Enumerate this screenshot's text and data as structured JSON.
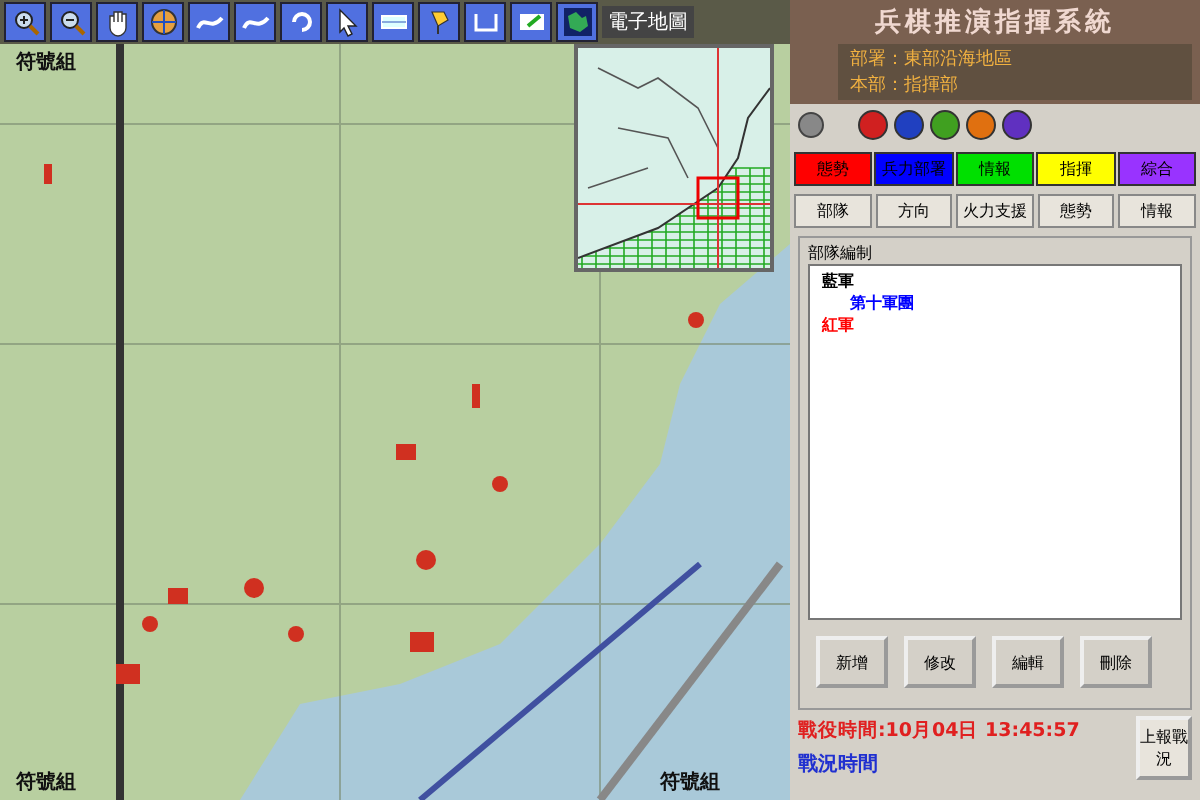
{
  "toolbar": {
    "tools": [
      {
        "kind": "zoom-in"
      },
      {
        "kind": "zoom-out"
      },
      {
        "kind": "pan"
      },
      {
        "kind": "globe"
      },
      {
        "kind": "curve"
      },
      {
        "kind": "curve"
      },
      {
        "kind": "rotate"
      },
      {
        "kind": "pointer"
      },
      {
        "kind": "layer"
      },
      {
        "kind": "pin"
      },
      {
        "kind": "bracket"
      },
      {
        "kind": "note"
      },
      {
        "kind": "map"
      }
    ],
    "minimap_label": "電子地圖"
  },
  "map": {
    "labels": [
      "符號組",
      "符號組",
      "符號組"
    ]
  },
  "header": {
    "title": "兵棋推演指揮系統",
    "lines": [
      "部署：東部沿海地區",
      "本部：指揮部"
    ],
    "lights": [
      {
        "color": "#d02020"
      },
      {
        "color": "#2040c0"
      },
      {
        "color": "#40a020"
      },
      {
        "color": "#e07010"
      },
      {
        "color": "#6030c0"
      }
    ]
  },
  "side_tabs": [
    {
      "label": "態勢",
      "color": "#ff0000"
    },
    {
      "label": "兵力部署",
      "color": "#0000ff"
    },
    {
      "label": "情報",
      "color": "#00e000"
    },
    {
      "label": "指揮",
      "color": "#ffff00"
    },
    {
      "label": "綜合",
      "color": "#9933ff"
    }
  ],
  "actions": [
    "部隊",
    "方向",
    "火力支援",
    "態勢",
    "情報"
  ],
  "tree": {
    "title": "部隊編制",
    "items": [
      {
        "label": "藍軍",
        "color": "#000000",
        "children": [
          {
            "label": "第十軍團",
            "color": "#0000ff"
          }
        ]
      },
      {
        "label": "紅軍",
        "color": "#ff0000"
      }
    ]
  },
  "buttons": [
    "新增",
    "修改",
    "編輯",
    "刪除"
  ],
  "status": {
    "time": "戰役時間:10月04日 13:45:57",
    "state": "戰況時間",
    "report_button": "上報戰況"
  }
}
